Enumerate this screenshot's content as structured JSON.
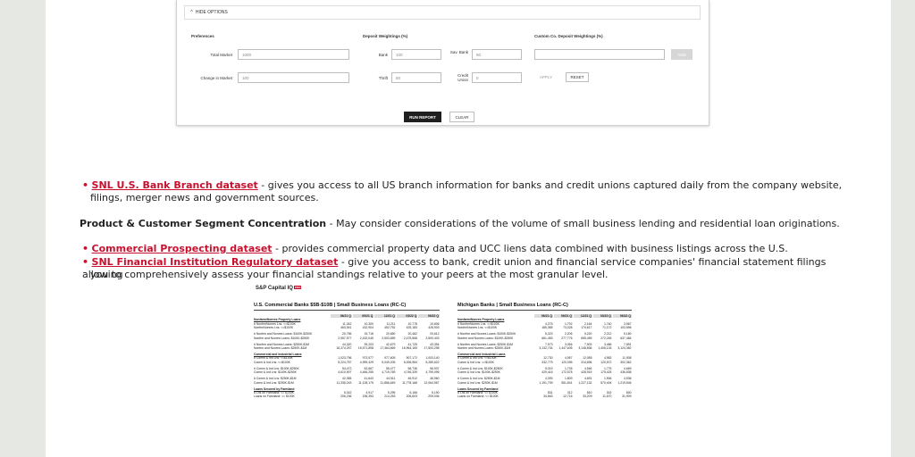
{
  "options_panel": {
    "toggle_label": "HIDE OPTIONS",
    "sections": {
      "preferences": "Preferences",
      "deposit_weightings": "Deposit Weightings (%)",
      "custom_weightings": "Custom Co. Deposit Weightings (%)"
    },
    "fields": {
      "total_market_label": "Total Market",
      "total_market_value": "1000",
      "change_in_market_label": "Change in Market",
      "change_in_market_value": "100",
      "bank_label": "Bank",
      "bank_value": "100",
      "thrift_label": "Thrift",
      "thrift_value": "50",
      "savings_bank_label": "Sav. Bank",
      "savings_bank_value": "50",
      "credit_union_label": "Credit Union",
      "credit_union_value": "0"
    },
    "buttons": {
      "add": "ADD",
      "apply": "APPLY",
      "reset": "RESET",
      "run_report": "RUN REPORT",
      "clear": "CLEAR"
    }
  },
  "content": {
    "bullet1_link": "SNL U.S. Bank Branch dataset",
    "bullet1_text": " - gives you access to all US branch information for banks and credit unions captured daily from the company website,",
    "bullet1_text2": "filings, merger news and government sources.",
    "heading_bold": "Product & Customer Segment Concentration",
    "heading_text": " - May consider considerations of the volume of small business lending and residential loan originations.",
    "bullet2_link": "Commercial Prospecting dataset",
    "bullet2_text": " - provides commercial property data and UCC liens data combined with business listings across the U.S.",
    "bullet3_link": "SNL Financial Institution Regulatory dataset",
    "bullet3_text": " - give you access to bank, credit union and financial service companies' financial statement filings allowing",
    "bullet3_text2": "you to comprehensively assess your financial standings relative to your peers at the most granular level."
  },
  "report": {
    "logo": "S&P Capital IQ",
    "logo_badge": "PRO",
    "left_title": "U.S. Commercial Banks $5B-$10B | Small Business Loans (RC-C)",
    "right_title": "Michigan Banks | Small Business Loans (RC-C)",
    "columns": [
      "06/21 Q",
      "09/21 Q",
      "12/21 Q",
      "03/22 Q",
      "06/22 Q"
    ],
    "left_rows": [
      {
        "type": "sec",
        "label": "Nonfarm/Nonres Property Loans"
      },
      {
        "label": "# NonfrmNonres Lns. <=$100K",
        "values": [
          "11,342",
          "10,300",
          "11,211",
          "10,778",
          "10,606"
        ]
      },
      {
        "label": "NonfrmNonres Lns. <=$100K",
        "values": [
          "463,941",
          "432,904",
          "452,752",
          "425,183",
          "428,903"
        ]
      },
      {
        "type": "gap"
      },
      {
        "label": "# Nonfrm and Nonres Loans: $100K-$250K",
        "values": [
          "20,756",
          "19,718",
          "20,650",
          "20,462",
          "20,612"
        ]
      },
      {
        "label": "Nonfrm and Nonres Loans: $100K-$250K",
        "values": [
          "2,557,577",
          "2,432,045",
          "2,503,659",
          "2,475,568",
          "2,500,403"
        ]
      },
      {
        "type": "gap"
      },
      {
        "label": "# Nonfrm and Nonres Loans: $250K-$1M",
        "values": [
          "44,320",
          "39,203",
          "42,679",
          "41,725",
          "43,394"
        ]
      },
      {
        "label": "Nonfrm and Nonres Loans: $250K-$1M",
        "values": [
          "16,374,257",
          "15,571,898",
          "17,364,669",
          "16,964,169",
          "17,500,298"
        ]
      },
      {
        "type": "gap"
      },
      {
        "type": "sec",
        "label": "Commercial and Industrial Loans"
      },
      {
        "label": "# Comm & Ind Lns: <=$100K",
        "values": [
          "1,023,796",
          "973,577",
          "977,609",
          "907,172",
          "1,003,140"
        ]
      },
      {
        "label": "Comm & Ind Lns: <=$100K",
        "values": [
          "5,224,757",
          "4,999,429",
          "5,049,205",
          "6,006,964",
          "5,289,622"
        ]
      },
      {
        "type": "gap"
      },
      {
        "label": "# Comm & Ind Lns: $100K-$250K",
        "values": [
          "54,472",
          "52,667",
          "55,477",
          "56,736",
          "56,937"
        ]
      },
      {
        "label": "Comm & Ind Lns: $100K-$250K",
        "values": [
          "4,610,907",
          "4,466,255",
          "4,719,769",
          "4,746,339",
          "4,799,096"
        ]
      },
      {
        "type": "gap"
      },
      {
        "label": "# Comm & Ind Lns: $250K-$1M",
        "values": [
          "42,365",
          "41,643",
          "44,511",
          "46,912",
          "46,960"
        ]
      },
      {
        "label": "Comm & Ind Lns: $250K-$1M",
        "values": [
          "11,335,243",
          "11,128,175",
          "11,866,649",
          "11,778,168",
          "12,064,967"
        ]
      },
      {
        "type": "gap"
      },
      {
        "type": "sec",
        "label": "Loans Secured by Farmland"
      },
      {
        "label": "# Lns on Farmland: <= $100K",
        "values": [
          "5,342",
          "4,917",
          "5,295",
          "5,166",
          "5,190"
        ]
      },
      {
        "label": "Loans on Farmland: <= $100K",
        "values": [
          "206,236",
          "196,393",
          "214,253",
          "206,603",
          "209,036"
        ]
      }
    ],
    "right_rows": [
      {
        "type": "sec",
        "label": "Nonfarm/Nonres Property Loans"
      },
      {
        "label": "# NonfrmNonres Lns. <=$100K",
        "values": [
          "4,275",
          "1,792",
          "2,164",
          "1,740",
          "3,567"
        ]
      },
      {
        "label": "NonfrmNonres Lns. <=$100K",
        "values": [
          "185,365",
          "73,328",
          "174,617",
          "71,172",
          "103,596"
        ]
      },
      {
        "type": "gap"
      },
      {
        "label": "# Nonfrm and Nonres Loans: $100K-$250K",
        "values": [
          "5,323",
          "2,206",
          "5,220",
          "2,212",
          "5,180"
        ]
      },
      {
        "label": "Nonfrm and Nonres Loans: $100K-$250K",
        "values": [
          "661,453",
          "277,776",
          "655,459",
          "272,245",
          "637,484"
        ]
      },
      {
        "type": "gap"
      },
      {
        "label": "# Nonfrm and Nonres Loans: $250K-$1M",
        "values": [
          "7,973",
          "3,056",
          "7,903",
          "3,486",
          "7,891"
        ]
      },
      {
        "label": "Nonfrm and Nonres Loans: $250K-$1M",
        "values": [
          "3,132,704",
          "1,447,605",
          "3,148,836",
          "1,406,133",
          "3,124,382"
        ]
      },
      {
        "type": "gap"
      },
      {
        "type": "sec",
        "label": "Commercial and Industrial Loans"
      },
      {
        "label": "# Comm & Ind Lns: <=$100K",
        "values": [
          "12,730",
          "4,957",
          "12,085",
          "4,983",
          "11,908"
        ]
      },
      {
        "label": "Comm & Ind Lns: <=$100K",
        "values": [
          "332,779",
          "120,395",
          "314,696",
          "120,572",
          "302,362"
        ]
      },
      {
        "type": "gap"
      },
      {
        "label": "# Comm & Ind Lns: $100K-$250K",
        "values": [
          "5,019",
          "1,735",
          "4,546",
          "1,775",
          "4,669"
        ]
      },
      {
        "label": "Comm & Ind Lns: $100K-$250K",
        "values": [
          "429,416",
          "172,578",
          "428,915",
          "175,425",
          "436,838"
        ]
      },
      {
        "type": "gap"
      },
      {
        "label": "# Comm & Ind Lns: $250K-$1M",
        "values": [
          "4,393",
          "1,809",
          "4,691",
          "1,906",
          "4,536"
        ]
      },
      {
        "label": "Comm & Ind Lns: $250K-$1M",
        "values": [
          "1,191,709",
          "551,841",
          "1,227,132",
          "570,404",
          "1,219,546"
        ]
      },
      {
        "type": "gap"
      },
      {
        "type": "sec",
        "label": "Loans Secured by Farmland"
      },
      {
        "label": "# Lns on Farmland: <= $100K",
        "values": [
          "831",
          "312",
          "810",
          "302",
          "800"
        ]
      },
      {
        "label": "Loans on Farmland: <= $100K",
        "values": [
          "34,663",
          "12,716",
          "33,209",
          "11,670",
          "31,909"
        ]
      }
    ]
  },
  "colors": {
    "accent": "#c8102e",
    "background": "#e6e8e4",
    "run_button": "#1f1f1f"
  }
}
